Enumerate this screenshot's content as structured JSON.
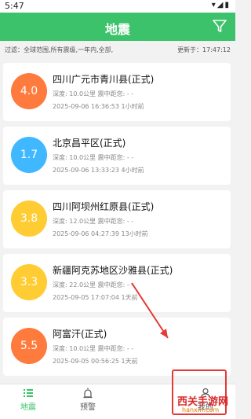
{
  "status_bar": {
    "time": "5:47",
    "icons": "▾◢▮"
  },
  "header": {
    "title": "地震",
    "filter_icon": "filter-icon"
  },
  "filter": {
    "summary": "过滤：全球范围,所有震级,一年内,全部,",
    "updated": "更新于：17:47:12"
  },
  "quakes": [
    {
      "magnitude": "4.0",
      "place": "四川广元市青川县(正式)",
      "depth_dist": "深度: 10.0公里   震中距您: - -",
      "time": "2025-09-06 16:36:53   1小时前",
      "color": "#ff7a3d"
    },
    {
      "magnitude": "1.7",
      "place": "北京昌平区(正式)",
      "depth_dist": "深度: 10.0公里   震中距您: - -",
      "time": "2025-09-06 13:33:23   4小时前",
      "color": "#3fb8ff"
    },
    {
      "magnitude": "3.8",
      "place": "四川阿坝州红原县(正式)",
      "depth_dist": "深度: 12.0公里   震中距您: - -",
      "time": "2025-09-06 04:27:39   13小时前",
      "color": "#ffcc33"
    },
    {
      "magnitude": "3.3",
      "place": "新疆阿克苏地区沙雅县(正式)",
      "depth_dist": "深度: 22.0公里   震中距您: - -",
      "time": "2025-09-05 17:07:04   1天前",
      "color": "#ffcc33"
    },
    {
      "magnitude": "5.5",
      "place": "阿富汗(正式)",
      "depth_dist": "深度: 10.0公里   震中距您: - -",
      "time": "2025-09-05 00:56:25   1天前",
      "color": "#ff7a3d"
    }
  ],
  "nav": {
    "items": [
      {
        "label": "地震",
        "icon": "list-icon",
        "color": "#3cc26a"
      },
      {
        "label": "预警",
        "icon": "alarm-icon",
        "color": "#555555"
      },
      {
        "label": "",
        "icon": "",
        "color": "#555555"
      },
      {
        "label": "我的",
        "icon": "person-icon",
        "color": "#555555"
      }
    ]
  },
  "watermark": {
    "text": "西关手游网",
    "sub": "hanxm.com"
  }
}
